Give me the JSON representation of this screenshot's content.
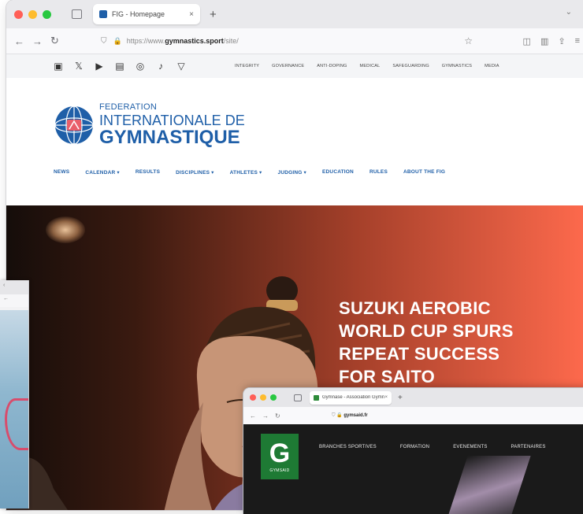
{
  "browser": {
    "tab_title": "FIG - Homepage",
    "tab_close": "×",
    "new_tab": "+",
    "url_prefix": "https://www.",
    "url_host": "gymnastics.sport",
    "url_suffix": "/site/",
    "nav_back": "←",
    "nav_forward": "→",
    "nav_reload": "↻"
  },
  "topbar": {
    "social_icons": [
      "facebook-icon",
      "x-icon",
      "youtube-icon",
      "linkedin-icon",
      "instagram-icon",
      "tiktok-icon",
      "vk-icon"
    ],
    "links": [
      "INTEGRITY",
      "GOVERNANCE",
      "ANTI-DOPING",
      "MEDICAL",
      "SAFEGUARDING",
      "GYMNASTICS",
      "MEDIA"
    ]
  },
  "logo": {
    "line1": "FEDERATION",
    "line2": "INTERNATIONALE DE",
    "line3": "GYMNASTIQUE",
    "brand_color": "#1f5fa8"
  },
  "mainnav": [
    "NEWS",
    "CALENDAR ▾",
    "RESULTS",
    "DISCIPLINES ▾",
    "ATHLETES ▾",
    "JUDGING ▾",
    "EDUCATION",
    "RULES",
    "ABOUT THE FIG"
  ],
  "hero": {
    "headline": [
      "SUZUKI AEROBIC",
      "WORLD CUP SPURS",
      "REPEAT SUCCESS",
      "FOR SAITO"
    ],
    "gradient_end": "#ff6a4d"
  },
  "gym_window": {
    "tab_title": "Gymnase - Association Gymn...",
    "tab_close": "×",
    "new_tab": "+",
    "url_host": "gymsaid.fr",
    "logo_letter": "G",
    "logo_sub": "GYMSAID",
    "nav": [
      "BRANCHES SPORTIVES",
      "FORMATION",
      "EVENEMENTS",
      "PARTENAIRES"
    ],
    "brand_color": "#1e7a34"
  }
}
